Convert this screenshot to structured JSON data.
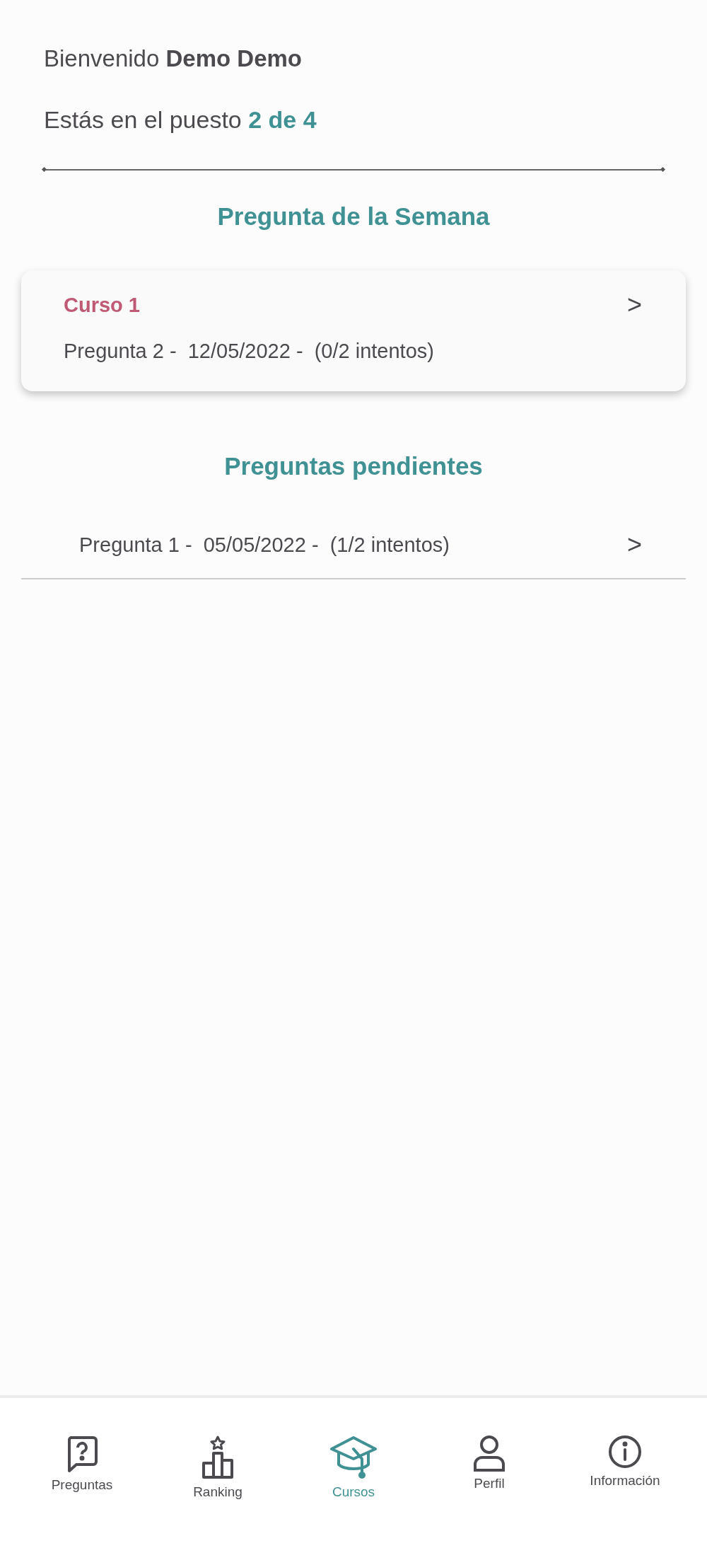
{
  "welcome": "Bienvenido **Demo Demo**",
  "rank": "Estás en el puesto **2 de 4**",
  "week_section": {
    "title": "Pregunta de la Semana",
    "card": {
      "course": "Curso 1",
      "text": "Pregunta 2 -  12/05/2022 -  (0/2 intentos)",
      "chevron": ">"
    }
  },
  "pending_section": {
    "title": "Preguntas pendientes",
    "rows": [
      {
        "text": "Pregunta 1 -  05/05/2022 -  (1/2 intentos)",
        "chevron": ">"
      }
    ]
  },
  "bottom_nav": [
    {
      "label": "Preguntas",
      "kind": "question",
      "selected": false
    },
    {
      "label": "Ranking",
      "kind": "ranking",
      "selected": false
    },
    {
      "label": "Cursos",
      "kind": "courses",
      "selected": true
    },
    {
      "label": "Perfil",
      "kind": "profile",
      "selected": false
    },
    {
      "label": "Información",
      "kind": "info",
      "selected": false
    }
  ]
}
